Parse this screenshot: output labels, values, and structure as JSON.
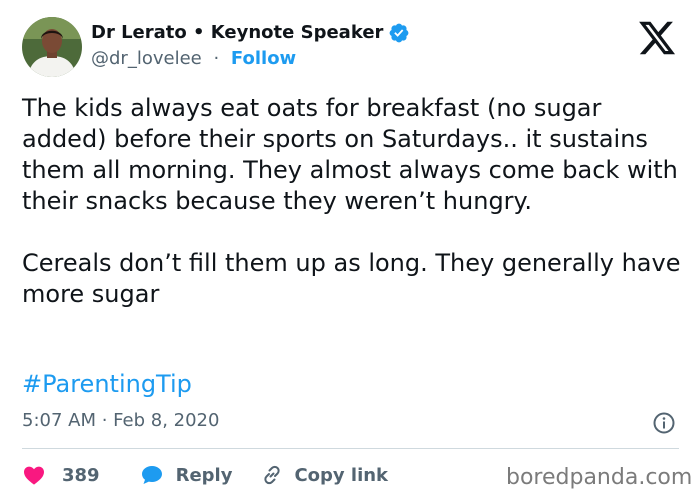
{
  "author": {
    "display_name": "Dr Lerato • Keynote Speaker",
    "handle": "@dr_lovelee",
    "separator": "·",
    "follow_label": "Follow",
    "verified": true
  },
  "tweet": {
    "paragraphs": [
      "The kids always eat oats for breakfast (no sugar added) before their sports on Saturdays.. it sustains them all morning. They almost always come back with their snacks because they weren’t hungry.",
      "Cereals don’t fill them up as long. They generally have more sugar"
    ],
    "hashtag": "#ParentingTip",
    "timestamp": "5:07 AM · Feb 8, 2020"
  },
  "actions": {
    "like_count": "389",
    "reply_label": "Reply",
    "copy_link_label": "Copy link"
  },
  "watermark": "boredpanda.com",
  "icons": {
    "platform": "x-logo-icon",
    "verified": "verified-badge-icon",
    "info": "info-icon",
    "like": "heart-icon",
    "reply": "speech-bubble-icon",
    "copy": "link-icon"
  },
  "colors": {
    "accent": "#1d9bf0",
    "like": "#f91880",
    "text": "#0f1419",
    "secondary_text": "#536471"
  }
}
